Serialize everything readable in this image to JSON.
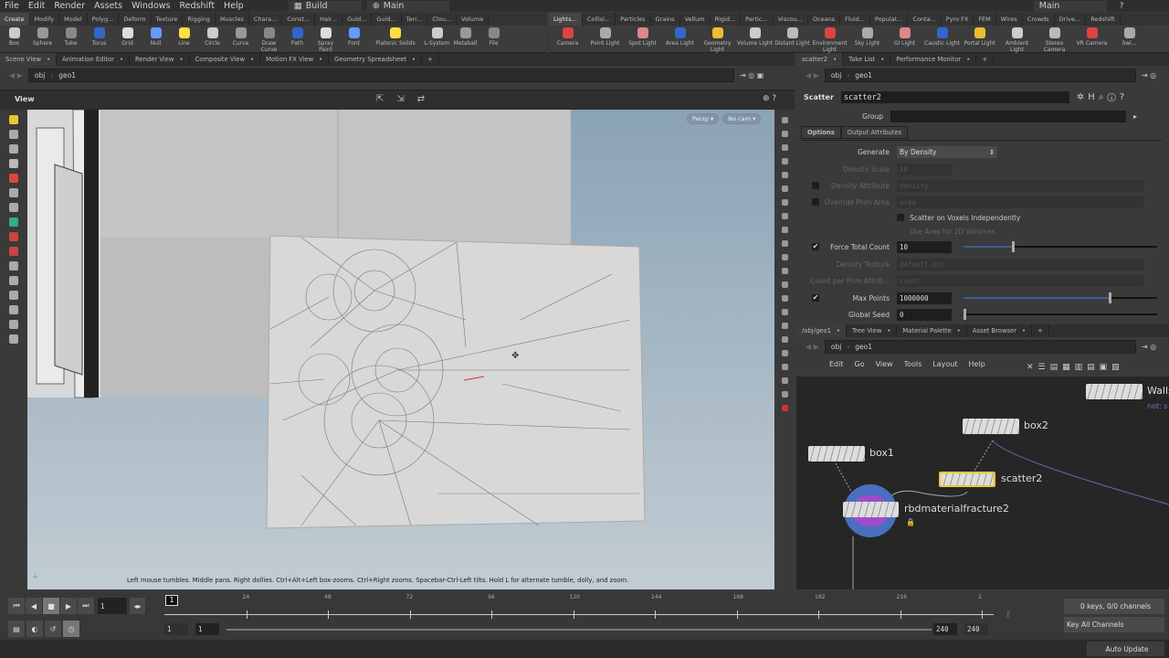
{
  "menu": {
    "items": [
      "File",
      "Edit",
      "Render",
      "Assets",
      "Windows",
      "Redshift",
      "Help"
    ],
    "desktop": "Build",
    "context": "Main",
    "context_right": "Main"
  },
  "shelf_left": {
    "tabs": [
      "Create",
      "Modify",
      "Model",
      "Polyg...",
      "Deform",
      "Texture",
      "Rigging",
      "Muscles",
      "Chara...",
      "Const...",
      "Hair...",
      "Guid...",
      "Guid...",
      "Terr...",
      "Clou...",
      "Volume"
    ],
    "tools": [
      "Box",
      "Sphere",
      "Tube",
      "Torus",
      "Grid",
      "Null",
      "Line",
      "Circle",
      "Curve",
      "Draw Curve",
      "Path",
      "Spray Paint",
      "Font",
      "Platonic Solids",
      "L-System",
      "Metaball",
      "File"
    ]
  },
  "shelf_right": {
    "tabs": [
      "Lights...",
      "Collisi...",
      "Particles",
      "Grains",
      "Vellum",
      "Rigid...",
      "Partic...",
      "Viscou...",
      "Oceans",
      "Fluid...",
      "Populat...",
      "Conta...",
      "Pyro FX",
      "FEM",
      "Wires",
      "Crowds",
      "Drive...",
      "Redshift"
    ],
    "tools": [
      "Camera",
      "Point Light",
      "Spot Light",
      "Area Light",
      "Geometry Light",
      "Volume Light",
      "Distant Light",
      "Environment Light",
      "Sky Light",
      "GI Light",
      "Caustic Light",
      "Portal Light",
      "Ambient Light",
      "Stereo Camera",
      "VR Camera",
      "Swi..."
    ]
  },
  "left_pane": {
    "tabs": [
      "Scene View",
      "Animation Editor",
      "Render View",
      "Composite View",
      "Motion FX View",
      "Geometry Spreadsheet"
    ],
    "path": [
      "obj",
      "geo1"
    ],
    "view_label": "View",
    "persp": "Persp ▾",
    "cam": "No cam ▾",
    "hint": "Left mouse tumbles. Middle pans. Right dollies. Ctrl+Alt+Left box-zooms. Ctrl+Right zooms. Spacebar-Ctrl-Left tilts. Hold L for alternate tumble, dolly, and zoom."
  },
  "param_pane": {
    "tabs": [
      "scatter2",
      "Take List",
      "Performance Monitor"
    ],
    "path": [
      "obj",
      "geo1"
    ],
    "node_type": "Scatter",
    "node_name": "scatter2",
    "group_label": "Group",
    "subtabs": [
      "Options",
      "Output Attributes"
    ],
    "generate": {
      "label": "Generate",
      "value": "By Density"
    },
    "density_scale": {
      "label": "Density Scale",
      "value": "10"
    },
    "density_attribute": {
      "label": "Density Attribute",
      "value": "density"
    },
    "override_prim_area": {
      "label": "Override Prim Area",
      "value": "area"
    },
    "scatter_voxels": "Scatter on Voxels Independently",
    "use_area": "Use Area for 2D Volumes",
    "force_total_count": {
      "label": "Force Total Count",
      "value": "10",
      "checked": true,
      "slider": 0.25
    },
    "density_texture": {
      "label": "Density Texture",
      "value": "default.pic"
    },
    "count_per_prim": {
      "label": "Count per Prim Attrib...",
      "value": "count"
    },
    "max_points": {
      "label": "Max Points",
      "value": "1000000",
      "checked": true,
      "slider": 0.75
    },
    "global_seed": {
      "label": "Global Seed",
      "value": "0",
      "slider": 0.0
    }
  },
  "network_pane": {
    "tabs": [
      "/obj/geo1",
      "Tree View",
      "Material Palette",
      "Asset Browser"
    ],
    "path": [
      "obj",
      "geo1"
    ],
    "menu": [
      "Edit",
      "Go",
      "View",
      "Tools",
      "Layout",
      "Help"
    ],
    "nodes": {
      "box1": "box1",
      "box2": "box2",
      "scatter2": "scatter2",
      "rbd": "rbdmaterialfracture2",
      "walls": "Walls",
      "walls_comment": "not: s"
    }
  },
  "timeline": {
    "current_frame": "1",
    "ticks": [
      "24",
      "48",
      "72",
      "96",
      "120",
      "144",
      "168",
      "192",
      "216",
      "2"
    ],
    "start": "1",
    "start2": "1",
    "end": "240",
    "end2": "240",
    "keys": "0 keys, 0/0 channels",
    "key_all": "Key All Channels",
    "auto_update": "Auto Update"
  },
  "colors": {
    "accent": "#3b5d99",
    "selected_node": "#e8c832",
    "bg": "#3a3a3a"
  }
}
